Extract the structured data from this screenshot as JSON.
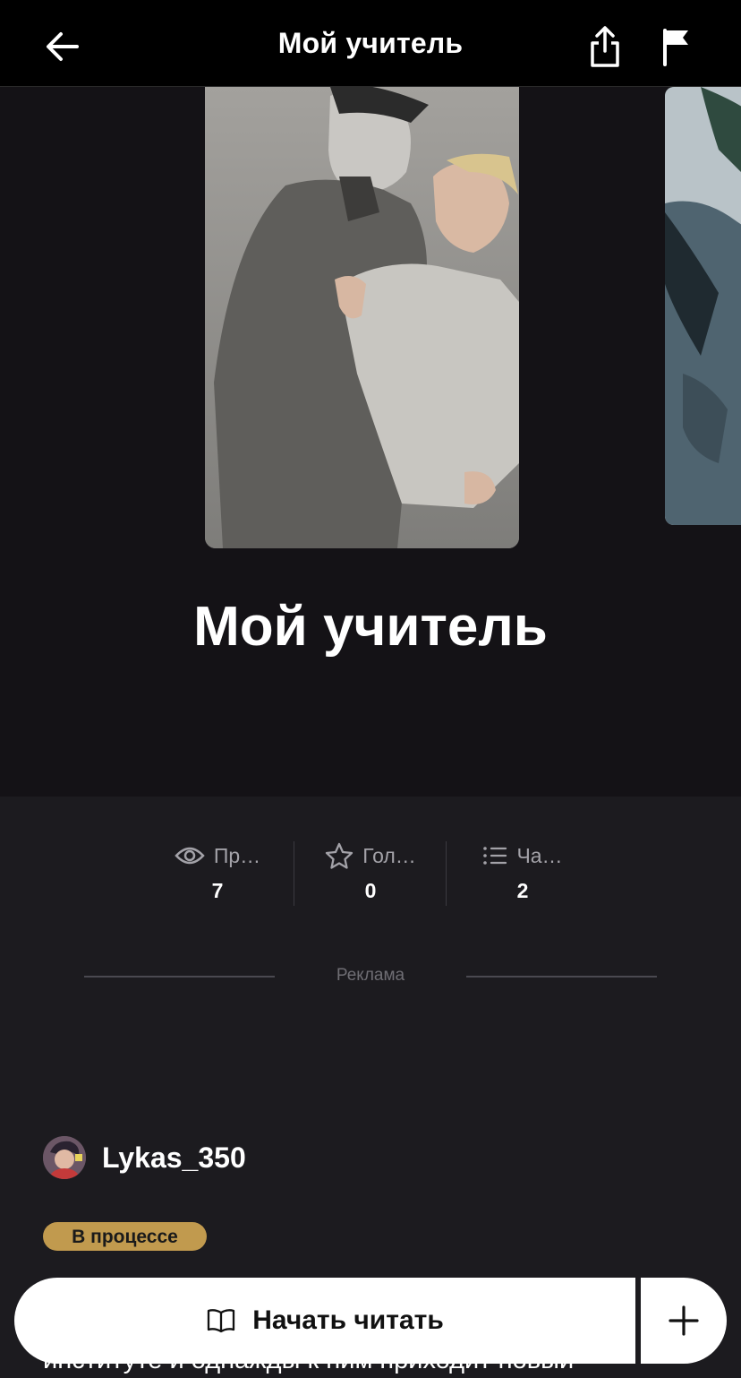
{
  "header": {
    "title": "Мой учитель",
    "back_icon": "arrow-left-icon",
    "share_icon": "share-icon",
    "report_icon": "flag-icon"
  },
  "book": {
    "title": "Мой учитель",
    "cover_icon": "book-cover-image"
  },
  "stats": [
    {
      "label": "Пр…",
      "value": "7",
      "icon": "eye-icon"
    },
    {
      "label": "Гол…",
      "value": "0",
      "icon": "star-icon"
    },
    {
      "label": "Ча…",
      "value": "2",
      "icon": "list-icon"
    }
  ],
  "ad": {
    "label": "Реклама"
  },
  "author": {
    "name": "Lykas_350"
  },
  "status": {
    "label": "В процессе",
    "color": "#c19a4e"
  },
  "description": {
    "partial_text": "институте и однажды к ним приходит новый"
  },
  "actions": {
    "start_label": "Начать читать",
    "start_icon": "book-open-icon",
    "add_icon": "plus-icon"
  }
}
